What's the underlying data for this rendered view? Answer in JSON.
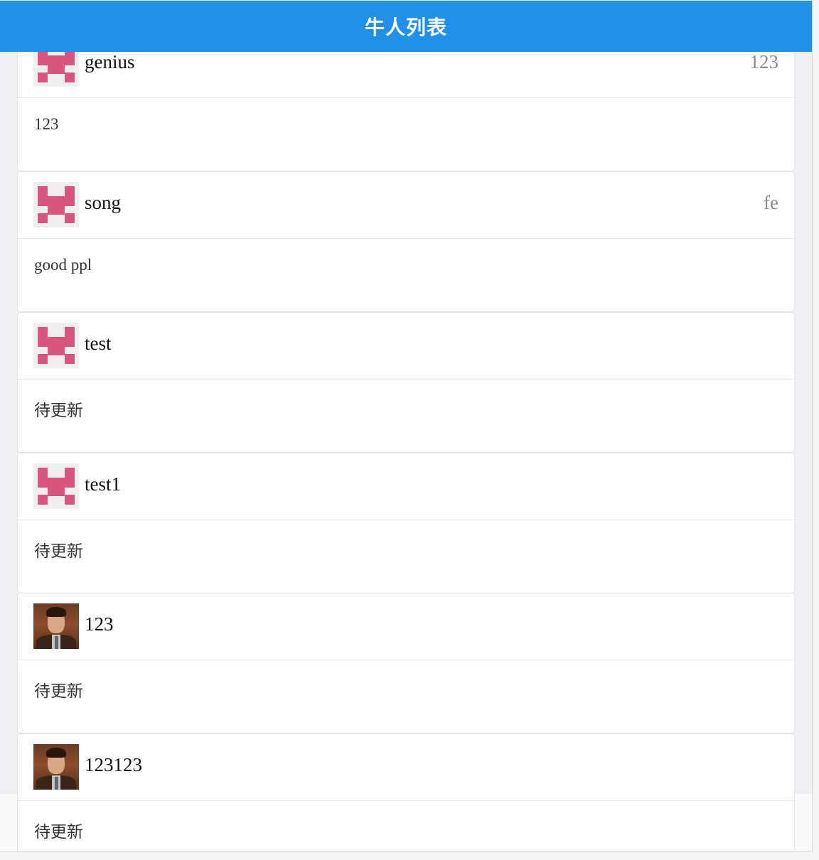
{
  "navbar": {
    "title": "牛人列表"
  },
  "cards": [
    {
      "name": "genius",
      "tag": "123",
      "description": "123",
      "avatar": "identicon"
    },
    {
      "name": "song",
      "tag": "fe",
      "description": "good ppl",
      "avatar": "identicon"
    },
    {
      "name": "test",
      "tag": "",
      "description": "待更新",
      "avatar": "identicon"
    },
    {
      "name": "test1",
      "tag": "",
      "description": "待更新",
      "avatar": "identicon"
    },
    {
      "name": "123",
      "tag": "",
      "description": "待更新",
      "avatar": "portrait-photo"
    },
    {
      "name": "123123",
      "tag": "",
      "description": "待更新",
      "avatar": "portrait-photo"
    }
  ],
  "colors": {
    "navbar": "#2190e6",
    "identicon": "#d8557d",
    "background": "#efeff4"
  }
}
